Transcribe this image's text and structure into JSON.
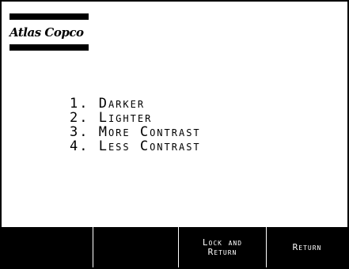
{
  "brand": {
    "logo_text": "Atlas Copco"
  },
  "menu": {
    "items": [
      {
        "label": "1. Darker"
      },
      {
        "label": "2. Lighter"
      },
      {
        "label": "3. More Contrast"
      },
      {
        "label": "4. Less Contrast"
      }
    ]
  },
  "softkeys": [
    {
      "label": ""
    },
    {
      "label": ""
    },
    {
      "label_line1": "Lock and",
      "label_line2": "Return"
    },
    {
      "label": "Return"
    }
  ],
  "colors": {
    "background": "#ffffff",
    "foreground": "#000000",
    "softkey_text": "#ffffff"
  }
}
